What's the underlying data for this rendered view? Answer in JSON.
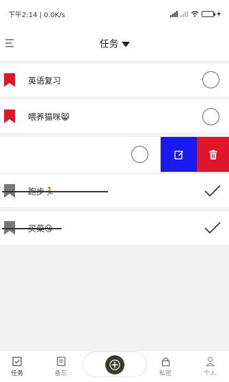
{
  "status_bar": {
    "time_speed": "下午2:14 | 0.0K/s"
  },
  "header": {
    "title": "任务"
  },
  "tasks": [
    {
      "text": "英语复习",
      "emoji": "",
      "done": false
    },
    {
      "text": "喂养猫咪",
      "emoji": "😸",
      "done": false
    },
    {
      "text": "跑步",
      "emoji": "🏃",
      "done": true
    },
    {
      "text": "买菜",
      "emoji": "😘",
      "done": true
    }
  ],
  "colors": {
    "flag_active": "#e0142a",
    "flag_done": "#777777",
    "edit_button": "#1a1af0",
    "delete_button": "#e0142a"
  },
  "icons": {
    "menu": "menu-icon",
    "dropdown": "caret-down-icon",
    "edit": "edit-icon",
    "delete": "trash-icon",
    "check": "check-icon",
    "add": "plus-icon"
  },
  "tabbar": {
    "items": [
      {
        "label": "任务",
        "icon": "task-icon"
      },
      {
        "label": "备忘",
        "icon": "memo-icon"
      },
      {
        "label": "私密",
        "icon": "lock-icon"
      },
      {
        "label": "个人",
        "icon": "person-icon"
      }
    ]
  }
}
